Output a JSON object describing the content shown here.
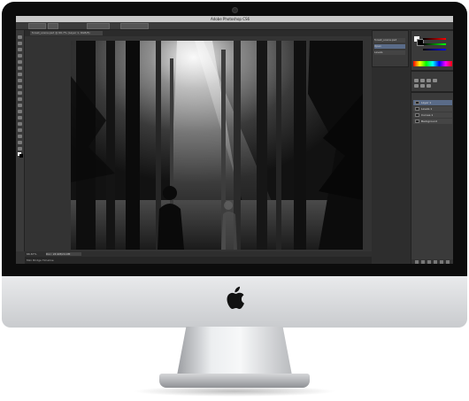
{
  "app": {
    "window_title": "Adobe Photoshop CS6",
    "document_tab": "forest_scene.psd @ 66.7% (Layer 1, RGB/8)",
    "zoom": "66.67%",
    "doc_size": "Doc: 24.9M/24.9M",
    "timeline_label": "Mini Bridge   Timeline"
  },
  "panels": {
    "history": {
      "rows": [
        "forest_scene.psd",
        "Open",
        "Levels"
      ]
    },
    "layers": {
      "rows": [
        "Layer 1",
        "Levels 1",
        "Curves 1",
        "Background"
      ]
    }
  },
  "colors": {
    "screen_bg": "#333333",
    "panel_bg": "#3a3a3a",
    "selection": "#5a6b88"
  },
  "icons": [
    "apple-logo",
    "camera-icon"
  ]
}
